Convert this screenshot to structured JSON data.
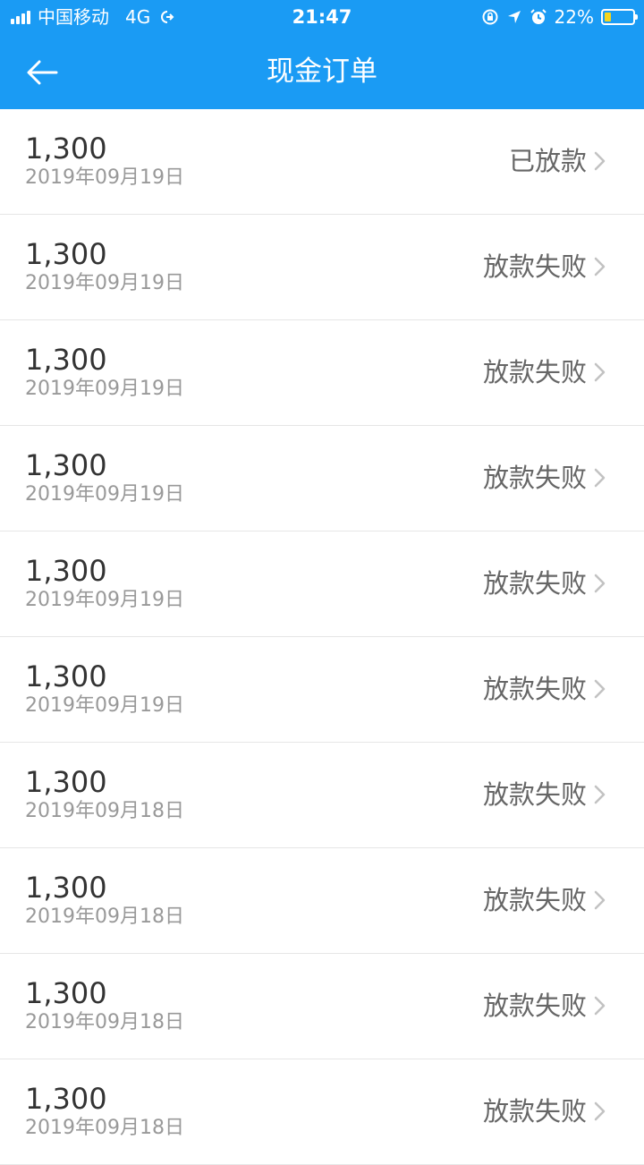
{
  "status_bar": {
    "carrier": "中国移动",
    "network": "4G",
    "time": "21:47",
    "battery_percent": "22%",
    "battery_level": 0.22,
    "battery_color": "#f7d51c"
  },
  "header": {
    "title": "现金订单",
    "background_color": "#1a9bf4",
    "back_icon": "arrow-left-icon"
  },
  "orders": [
    {
      "amount": "1,300",
      "date": "2019年09月19日",
      "status": "已放款"
    },
    {
      "amount": "1,300",
      "date": "2019年09月19日",
      "status": "放款失败"
    },
    {
      "amount": "1,300",
      "date": "2019年09月19日",
      "status": "放款失败"
    },
    {
      "amount": "1,300",
      "date": "2019年09月19日",
      "status": "放款失败"
    },
    {
      "amount": "1,300",
      "date": "2019年09月19日",
      "status": "放款失败"
    },
    {
      "amount": "1,300",
      "date": "2019年09月19日",
      "status": "放款失败"
    },
    {
      "amount": "1,300",
      "date": "2019年09月18日",
      "status": "放款失败"
    },
    {
      "amount": "1,300",
      "date": "2019年09月18日",
      "status": "放款失败"
    },
    {
      "amount": "1,300",
      "date": "2019年09月18日",
      "status": "放款失败"
    },
    {
      "amount": "1,300",
      "date": "2019年09月18日",
      "status": "放款失败"
    }
  ]
}
